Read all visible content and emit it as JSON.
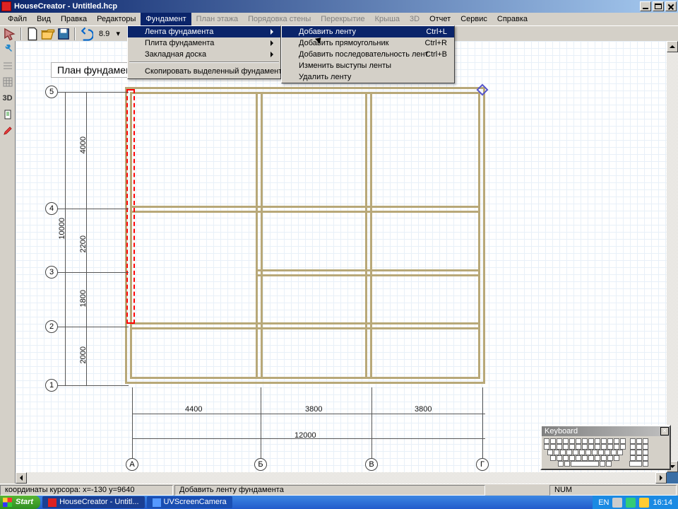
{
  "window": {
    "title": "HouseCreator - Untitled.hcp",
    "min": "_",
    "max": "□",
    "close": "×"
  },
  "menubar": {
    "items": [
      {
        "label": "Файл",
        "dim": false
      },
      {
        "label": "Вид",
        "dim": false
      },
      {
        "label": "Правка",
        "dim": false
      },
      {
        "label": "Редакторы",
        "dim": false
      },
      {
        "label": "Фундамент",
        "dim": false,
        "open": true
      },
      {
        "label": "План этажа",
        "dim": true
      },
      {
        "label": "Порядовка стены",
        "dim": true
      },
      {
        "label": "Перекрытие",
        "dim": true
      },
      {
        "label": "Крыша",
        "dim": true
      },
      {
        "label": "3D",
        "dim": true
      },
      {
        "label": "Отчет",
        "dim": false
      },
      {
        "label": "Сервис",
        "dim": false
      },
      {
        "label": "Справка",
        "dim": false
      }
    ]
  },
  "toolbar": {
    "coord_value": "8.9",
    "icons": [
      "new",
      "open",
      "save",
      "undo",
      "coord",
      "cursor"
    ]
  },
  "dropdown1": {
    "items": [
      {
        "label": "Лента фундамента",
        "sub": true,
        "hl": true
      },
      {
        "label": "Плита фундамента",
        "sub": true
      },
      {
        "label": "Закладная доска",
        "sub": true
      }
    ],
    "copy": "Скопировать выделенный фундамент"
  },
  "dropdown2": {
    "items": [
      {
        "label": "Добавить ленту",
        "shortcut": "Ctrl+L",
        "hl": true
      },
      {
        "label": "Добавить прямоугольник",
        "shortcut": "Ctrl+R"
      },
      {
        "label": "Добавить последовательность лент",
        "shortcut": "Ctrl+B"
      },
      {
        "label": "Изменить выступы ленты",
        "shortcut": ""
      },
      {
        "label": "Удалить ленту",
        "shortcut": ""
      }
    ]
  },
  "plan": {
    "title_label": "План фундамента:",
    "axes_v": [
      "5",
      "4",
      "3",
      "2",
      "1"
    ],
    "axes_h": [
      "А",
      "Б",
      "В",
      "Г"
    ],
    "dims_v_outer": "10000",
    "dims_v_inner": [
      "4000",
      "2200",
      "1800",
      "2000"
    ],
    "dims_h_outer": "12000",
    "dims_h_inner": [
      "4400",
      "3800",
      "3800"
    ]
  },
  "status": {
    "coords": "координаты курсора: x=-130 y=9640",
    "hint": "Добавить ленту фундамента",
    "num": "NUM"
  },
  "taskbar": {
    "start": "Start",
    "tasks": [
      {
        "label": "HouseCreator - Untitl...",
        "active": true
      },
      {
        "label": "UVScreenCamera",
        "active": false
      }
    ],
    "lang": "EN",
    "clock": "16:14"
  },
  "keyboard": {
    "title": "Keyboard"
  }
}
